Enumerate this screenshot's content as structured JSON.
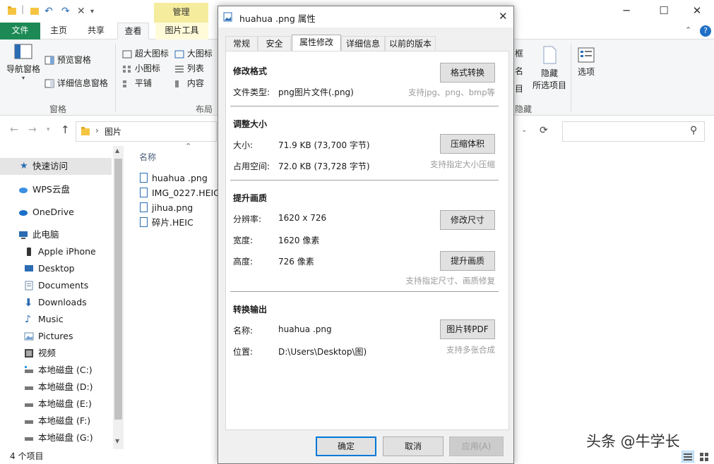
{
  "explorer": {
    "context_tab": "管理",
    "tabs": {
      "file": "文件",
      "home": "主页",
      "share": "共享",
      "view": "查看",
      "picture_tools": "图片工具"
    },
    "ribbon": {
      "nav_pane": "导航窗格",
      "preview_pane": "预览窗格",
      "details_pane": "详细信息窗格",
      "pane_group": "窗格",
      "extra_large": "超大图标",
      "large": "大图标",
      "small": "小图标",
      "list": "列表",
      "tiles": "平铺",
      "content": "内容",
      "layout_group": "布局",
      "frame": "框",
      "name": "名",
      "item": "目",
      "hide": "隐藏",
      "hide_selected": "所选项目",
      "options": "选项",
      "hide_group": "隐藏"
    },
    "address": {
      "folder": "图片"
    },
    "column_name": "名称",
    "nav": [
      {
        "label": "快速访问",
        "icon": "pin-icon"
      },
      {
        "label": "WPS云盘",
        "icon": "cloud-icon"
      },
      {
        "label": "OneDrive",
        "icon": "onedrive-icon"
      },
      {
        "label": "此电脑",
        "icon": "computer-icon"
      },
      {
        "label": "Apple iPhone",
        "icon": "phone-icon"
      },
      {
        "label": "Desktop",
        "icon": "desktop-icon"
      },
      {
        "label": "Documents",
        "icon": "documents-icon"
      },
      {
        "label": "Downloads",
        "icon": "download-icon"
      },
      {
        "label": "Music",
        "icon": "music-icon"
      },
      {
        "label": "Pictures",
        "icon": "pictures-icon"
      },
      {
        "label": "视频",
        "icon": "video-icon"
      },
      {
        "label": "本地磁盘 (C:)",
        "icon": "drive-icon"
      },
      {
        "label": "本地磁盘 (D:)",
        "icon": "drive-icon"
      },
      {
        "label": "本地磁盘 (E:)",
        "icon": "drive-icon"
      },
      {
        "label": "本地磁盘 (F:)",
        "icon": "drive-icon"
      },
      {
        "label": "本地磁盘 (G:)",
        "icon": "drive-icon"
      }
    ],
    "files": [
      "huahua .png",
      "IMG_0227.HEIC",
      "jihua.png",
      "碎片.HEIC"
    ],
    "status": "4 个项目"
  },
  "dialog": {
    "title": "huahua .png 属性",
    "tabs": [
      "常规",
      "安全",
      "属性修改",
      "详细信息",
      "以前的版本"
    ],
    "sections": {
      "format": {
        "heading": "修改格式",
        "type_label": "文件类型:",
        "type_value": "png图片文件(.png)",
        "button": "格式转换",
        "hint": "支持jpg、png、bmp等"
      },
      "size": {
        "heading": "调整大小",
        "size_label": "大小:",
        "size_value": "71.9 KB (73,700 字节)",
        "disk_label": "占用空间:",
        "disk_value": "72.0 KB (73,728 字节)",
        "button": "压缩体积",
        "hint": "支持指定大小压缩"
      },
      "quality": {
        "heading": "提升画质",
        "res_label": "分辨率:",
        "res_value": "1620 x 726",
        "width_label": "宽度:",
        "width_value": "1620 像素",
        "height_label": "高度:",
        "height_value": "726 像素",
        "resize_button": "修改尺寸",
        "enhance_button": "提升画质",
        "hint": "支持指定尺寸、画质修复"
      },
      "export": {
        "heading": "转换输出",
        "name_label": "名称:",
        "name_value": "huahua .png",
        "loc_label": "位置:",
        "loc_value": "D:\\Users\\Desktop\\图)",
        "button": "图片转PDF",
        "hint": "支持多张合成"
      }
    },
    "ok": "确定",
    "cancel": "取消",
    "apply": "应用(A)"
  },
  "watermark": "头条 @牛学长"
}
